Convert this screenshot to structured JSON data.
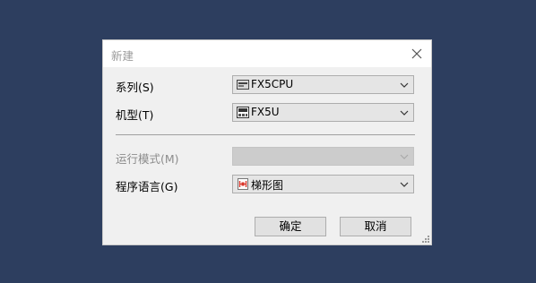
{
  "dialog": {
    "title": "新建",
    "fields": {
      "series": {
        "label": "系列(S)",
        "value": "FX5CPU",
        "icon": "cpu-module-icon",
        "enabled": true
      },
      "model": {
        "label": "机型(T)",
        "value": "FX5U",
        "icon": "plc-model-icon",
        "enabled": true
      },
      "run_mode": {
        "label": "运行模式(M)",
        "value": "",
        "enabled": false
      },
      "language": {
        "label": "程序语言(G)",
        "value": "梯形图",
        "icon": "ladder-diagram-icon",
        "enabled": true
      }
    },
    "buttons": {
      "ok": "确定",
      "cancel": "取消"
    }
  },
  "colors": {
    "desktop": "#2d3e5f",
    "dialog_bg": "#f0f0f0",
    "title_text": "#9a9a9a",
    "ladder_icon_red": "#d9352a"
  }
}
